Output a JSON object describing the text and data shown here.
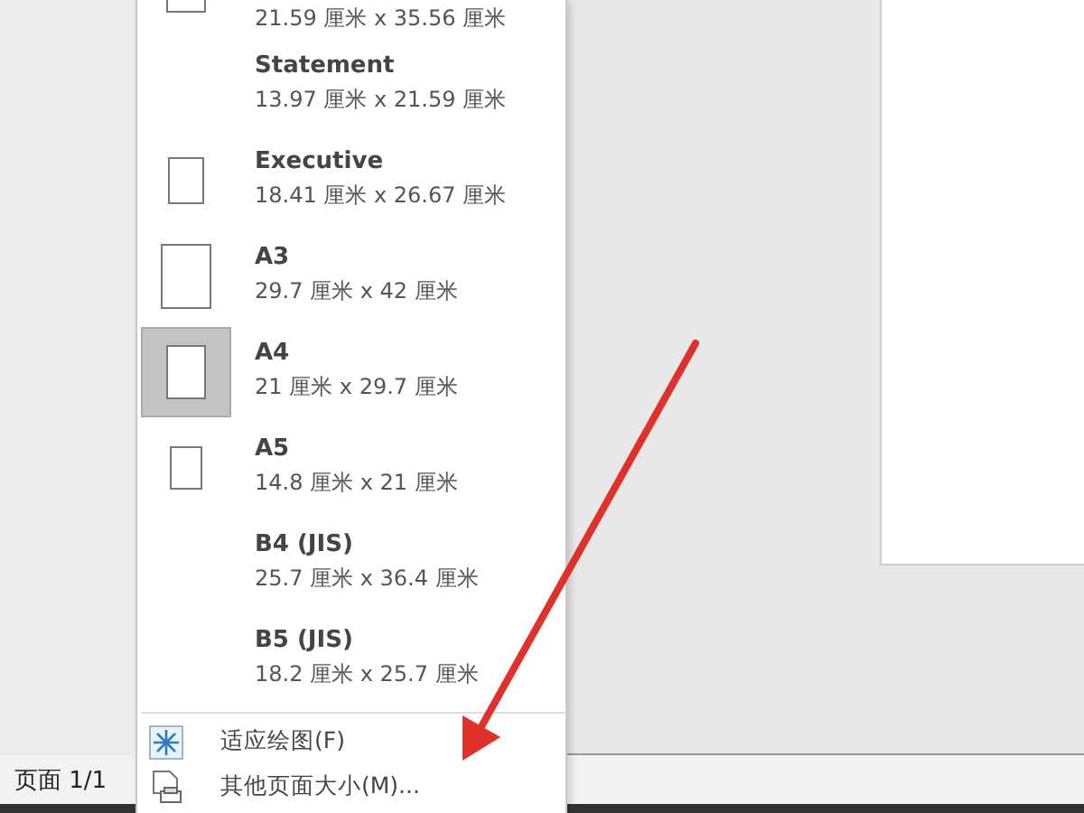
{
  "page_sizes": [
    {
      "size": "21.59 厘米 x 35.56 厘米",
      "selected": false
    },
    {
      "name": "Statement",
      "size": "13.97 厘米 x 21.59 厘米",
      "selected": false
    },
    {
      "name": "Executive",
      "size": "18.41 厘米 x 26.67 厘米",
      "selected": false
    },
    {
      "name": "A3",
      "size": "29.7 厘米 x 42 厘米",
      "selected": false
    },
    {
      "name": "A4",
      "size": "21 厘米 x 29.7 厘米",
      "selected": true
    },
    {
      "name": "A5",
      "size": "14.8 厘米 x 21 厘米",
      "selected": false
    },
    {
      "name": "B4 (JIS)",
      "size": "25.7 厘米 x 36.4 厘米",
      "selected": false
    },
    {
      "name": "B5 (JIS)",
      "size": "18.2 厘米 x 25.7 厘米",
      "selected": false
    }
  ],
  "menu_commands": [
    {
      "label": "适应绘图(F)",
      "kind": "fit"
    },
    {
      "label": "其他页面大小(M)...",
      "kind": "more"
    }
  ],
  "status_bar": {
    "page": "页面 1/1"
  }
}
